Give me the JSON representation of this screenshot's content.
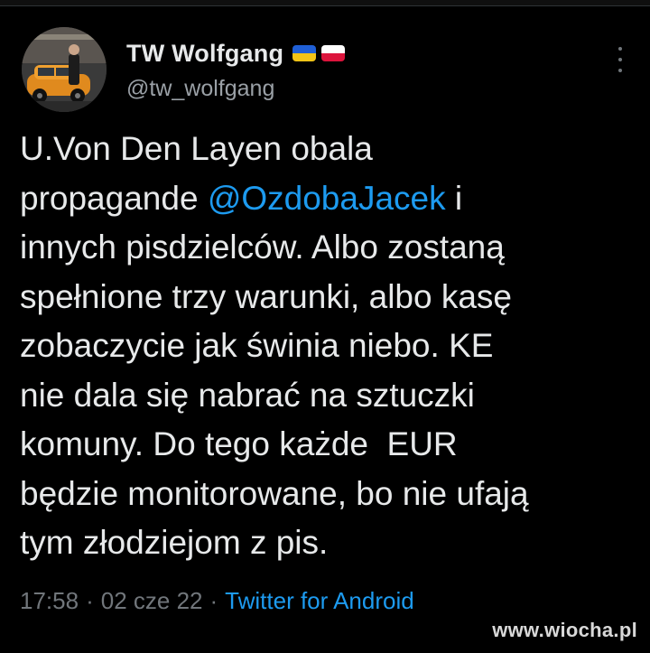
{
  "user": {
    "display_name": "TW Wolfgang",
    "handle": "@tw_wolfgang",
    "flags": [
      {
        "name": "ukraine-flag",
        "colors": [
          "#1f5fd6",
          "#f2c417"
        ]
      },
      {
        "name": "poland-flag",
        "colors": [
          "#ffffff",
          "#dc143c"
        ]
      }
    ]
  },
  "tweet": {
    "text_before_mention": "U.Von Den Layen obala\npropagande ",
    "mention": "@OzdobaJacek",
    "text_after_mention": " i\ninnych pisdzielców. Albo zostaną\nspełnione trzy warunki, albo kasę\nzobaczycie jak świnia niebo. KE\nnie dala się nabrać na sztuczki\nkomuny. Do tego każde  EUR\nbędzie monitorowane, bo nie ufają\ntym złodziejom z pis."
  },
  "meta": {
    "time": "17:58",
    "separator": "·",
    "date": "02 cze 22",
    "source": "Twitter for Android"
  },
  "watermark": "www.wiocha.pl",
  "colors": {
    "background": "#000000",
    "text": "#e7e9ea",
    "secondary": "#71767b",
    "accent": "#1d9bf0"
  }
}
